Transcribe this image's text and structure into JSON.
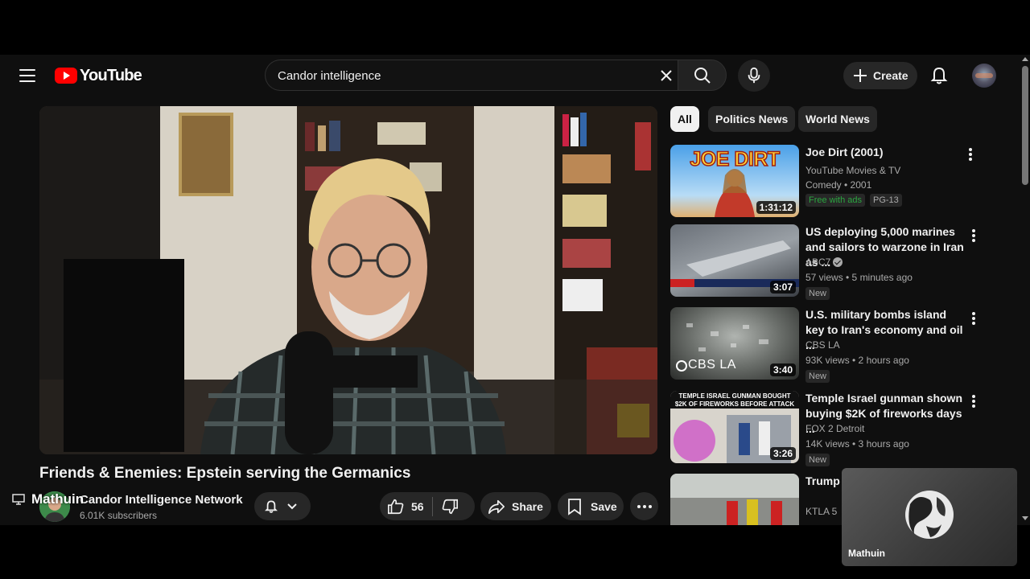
{
  "header": {
    "logo_text": "YouTube",
    "search_value": "Candor intelligence",
    "create_label": "Create"
  },
  "video": {
    "title": "Friends & Enemies: Epstein serving the Germanics",
    "channel": "Candor Intelligence Network",
    "subscribers": "6.01K subscribers",
    "like_count": "56",
    "share_label": "Share",
    "save_label": "Save"
  },
  "presenter": {
    "name": "Mathuin"
  },
  "chips": [
    "All",
    "Politics News",
    "World News"
  ],
  "recommendations": [
    {
      "title": "Joe Dirt (2001)",
      "channel": "YouTube Movies & TV",
      "meta": "Comedy • 2001",
      "badges": [
        "Free with ads",
        "PG-13"
      ],
      "duration": "1:31:12",
      "thumb_text": "JOE DIRT"
    },
    {
      "title": "US deploying 5,000 marines and sailors to warzone in Iran as ...",
      "channel": "ABC7",
      "meta": "57 views • 5 minutes ago",
      "badges": [
        "New"
      ],
      "duration": "3:07"
    },
    {
      "title": "U.S. military bombs island key to Iran's economy and oil ...",
      "channel": "CBS LA",
      "meta": "93K views • 2 hours ago",
      "badges": [
        "New"
      ],
      "duration": "3:40",
      "thumb_text": "CBS LA"
    },
    {
      "title": "Temple Israel gunman shown buying $2K of fireworks days ...",
      "channel": "FOX 2 Detroit",
      "meta": "14K views • 3 hours ago",
      "badges": [
        "New"
      ],
      "duration": "3:26",
      "thumb_text": "TEMPLE ISRAEL GUNMAN BOUGHT $2K OF FIREWORKS BEFORE ATTACK"
    },
    {
      "title": "Trump s... military...",
      "channel": "KTLA 5",
      "meta": "",
      "badges": [],
      "duration": ""
    }
  ],
  "colors": {
    "background": "#0f0f0f",
    "brand_red": "#ff0000",
    "free_green": "#3ea6ff"
  }
}
